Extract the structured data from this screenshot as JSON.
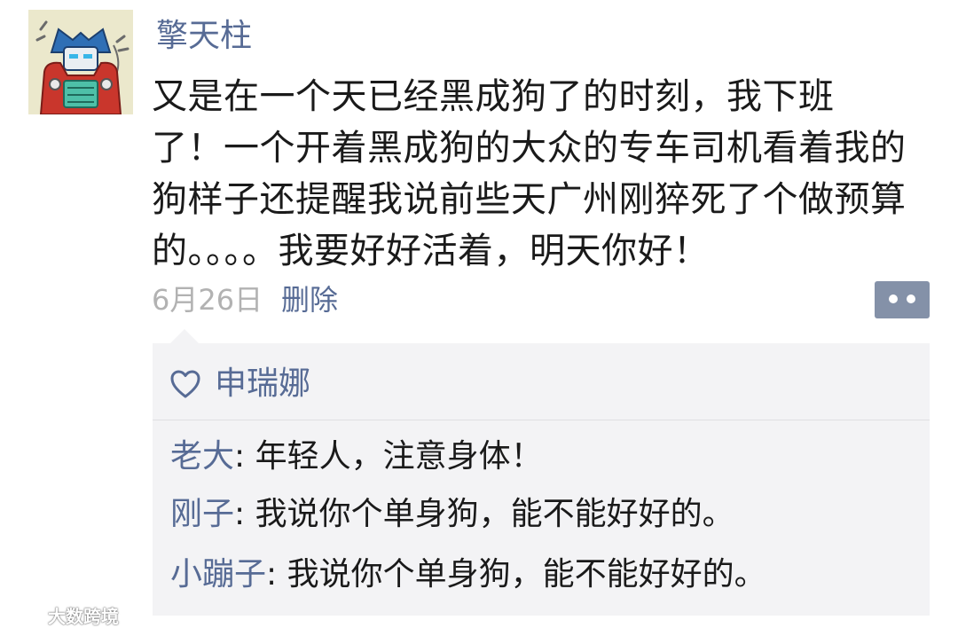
{
  "post": {
    "author": "擎天柱",
    "avatar_icon": "robot-cartoon-avatar",
    "text": "又是在一个天已经黑成狗了的时刻，我下班\n了！一个开着黑成狗的大众的专车司机看着我的\n狗样子还提醒我说前些天广州刚猝死了个做预算\n的。。。。我要好好活着，明天你好！",
    "date": "6月26日",
    "delete_label": "删除",
    "more_icon": "more-dots-icon"
  },
  "likes": {
    "icon": "heart-icon",
    "names": "申瑞娜"
  },
  "comments": [
    {
      "name": "老大",
      "sep": ": ",
      "text": "年轻人，注意身体！"
    },
    {
      "name": "刚子",
      "sep": ": ",
      "text": "我说你个单身狗，能不能好好的。"
    },
    {
      "name": "小蹦子",
      "sep": ": ",
      "text": "我说你个单身狗，能不能好好的。"
    }
  ],
  "watermark": {
    "text": "大数跨境",
    "icon": "brand-logo-icon"
  },
  "colors": {
    "link": "#576b95",
    "text": "#1a1a1a",
    "meta": "#b2b2b2",
    "comment_bg": "#f3f3f5",
    "more_button": "#8491a8"
  }
}
